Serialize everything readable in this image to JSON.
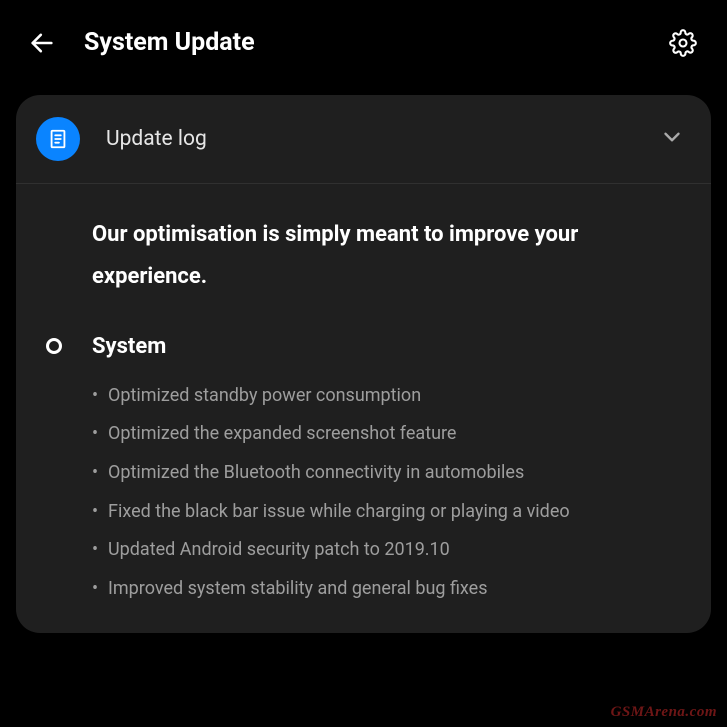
{
  "header": {
    "title": "System Update"
  },
  "card": {
    "title": "Update log",
    "intro": "Our optimisation is simply meant to improve your experience.",
    "section_title": "System",
    "bullets": [
      "Optimized standby power consumption",
      "Optimized the expanded screenshot feature",
      "Optimized the Bluetooth connectivity in automobiles",
      "Fixed the black bar issue while charging or playing a video",
      "Updated Android security patch to 2019.10",
      "Improved system stability and general bug fixes"
    ]
  },
  "watermark": "GSMArena.com"
}
